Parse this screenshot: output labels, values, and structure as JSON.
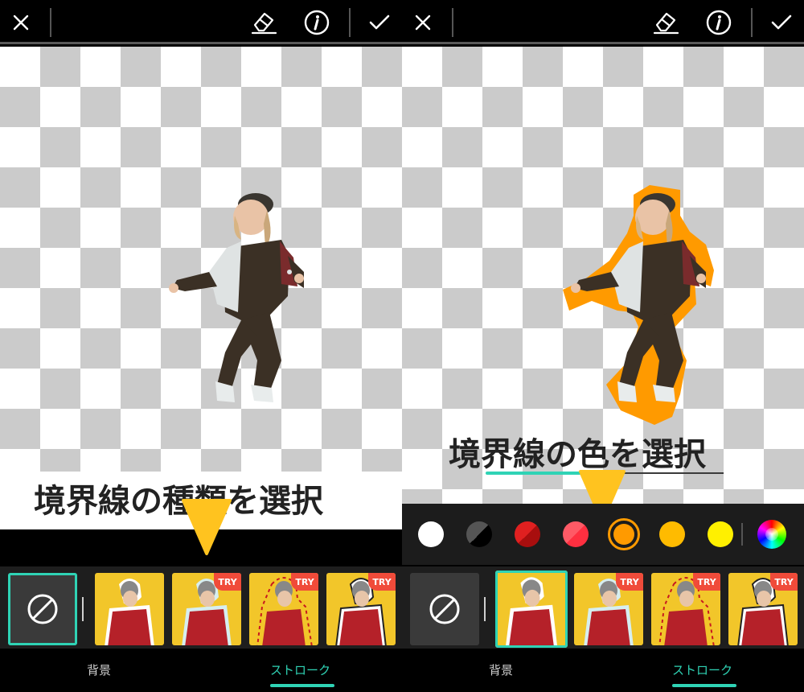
{
  "left_panel": {
    "caption": "境界線の種類を選択",
    "tabs": [
      {
        "label": "背景",
        "active": false
      },
      {
        "label": "ストローク",
        "active": true
      }
    ],
    "thumbnails": [
      {
        "kind": "none",
        "selected": true
      },
      {
        "kind": "stroke-white",
        "selected": false,
        "badge": ""
      },
      {
        "kind": "stroke-light",
        "selected": false,
        "badge": "TRY"
      },
      {
        "kind": "stroke-dashed",
        "selected": false,
        "badge": "TRY"
      },
      {
        "kind": "stroke-dark",
        "selected": false,
        "badge": "TRY"
      }
    ]
  },
  "right_panel": {
    "caption": "境界線の色を選択",
    "stroke_color": "#ff9a00",
    "swatches": [
      {
        "name": "white",
        "color": "#ffffff",
        "selected": false
      },
      {
        "name": "black-white",
        "color": "#000000",
        "selected": false
      },
      {
        "name": "dark-red",
        "color": "#c81818",
        "selected": false
      },
      {
        "name": "red",
        "color": "#ff3a48",
        "selected": false
      },
      {
        "name": "orange",
        "color": "#ff9a00",
        "selected": true
      },
      {
        "name": "amber",
        "color": "#ffbb00",
        "selected": false
      },
      {
        "name": "yellow",
        "color": "#fff000",
        "selected": false
      },
      {
        "name": "color-wheel",
        "color": "rainbow",
        "selected": false
      }
    ],
    "tabs": [
      {
        "label": "背景",
        "active": false
      },
      {
        "label": "ストローク",
        "active": true
      }
    ],
    "thumbnails": [
      {
        "kind": "none",
        "selected": false
      },
      {
        "kind": "stroke-white",
        "selected": true,
        "badge": ""
      },
      {
        "kind": "stroke-light",
        "selected": false,
        "badge": "TRY"
      },
      {
        "kind": "stroke-dashed",
        "selected": false,
        "badge": "TRY"
      },
      {
        "kind": "stroke-dark",
        "selected": false,
        "badge": "TRY"
      }
    ]
  },
  "colors": {
    "accent": "#2fd3b5",
    "arrow": "#ffc31f",
    "try_badge": "#f04b3a"
  },
  "icons": {
    "close": "close-icon",
    "eraser": "eraser-icon",
    "info": "info-icon",
    "apply": "checkmark-icon",
    "none": "no-stroke-icon"
  }
}
